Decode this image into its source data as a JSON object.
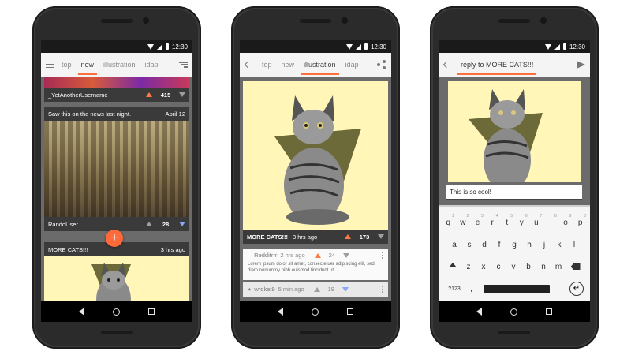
{
  "status_time": "12:30",
  "phone1": {
    "tabs": [
      "top",
      "new",
      "illustration",
      "idap"
    ],
    "active_tab": "new",
    "posts": [
      {
        "user": "_YetAnotherUsername",
        "score": "415"
      },
      {
        "title": "Saw this on the news last night.",
        "date": "April 12",
        "user": "RandoUser",
        "score": "28"
      },
      {
        "title": "MORE CATS!!!",
        "date": "3 hrs ago"
      }
    ],
    "fab_label": "+"
  },
  "phone2": {
    "tabs": [
      "top",
      "new",
      "illustration",
      "idap"
    ],
    "active_tab": "illustration",
    "post": {
      "title": "MORE CATS!!!",
      "time": "3 hrs ago",
      "score": "173"
    },
    "comments": [
      {
        "prefix": "–",
        "user": "Redditrrr",
        "time": "2 hrs ago",
        "score": "24",
        "body": "Lorem ipsum dolor sit amet, consectetuer adipiscing elit, sed diam nonummy nibh euismod tincidunt ut."
      },
      {
        "prefix": "+",
        "user": "wrdkat9",
        "time": "5 min ago",
        "score": "19"
      }
    ]
  },
  "phone3": {
    "title": "reply to MORE CATS!!!",
    "reply_text": "This is so cool!",
    "keyboard": {
      "row1": [
        "q",
        "w",
        "e",
        "r",
        "t",
        "y",
        "u",
        "i",
        "o",
        "p"
      ],
      "row1_hints": [
        "1",
        "2",
        "3",
        "4",
        "5",
        "6",
        "7",
        "8",
        "9",
        "0"
      ],
      "row2": [
        "a",
        "s",
        "d",
        "f",
        "g",
        "h",
        "j",
        "k",
        "l"
      ],
      "row3": [
        "z",
        "x",
        "c",
        "v",
        "b",
        "n",
        "m"
      ],
      "symbols_key": "?123",
      "comma": ",",
      "period": ".",
      "enter": "↵"
    }
  },
  "colors": {
    "accent": "#ff6f3c",
    "cat_bg": "#fff6b8",
    "downvote_blue": "#8aa6ff"
  }
}
